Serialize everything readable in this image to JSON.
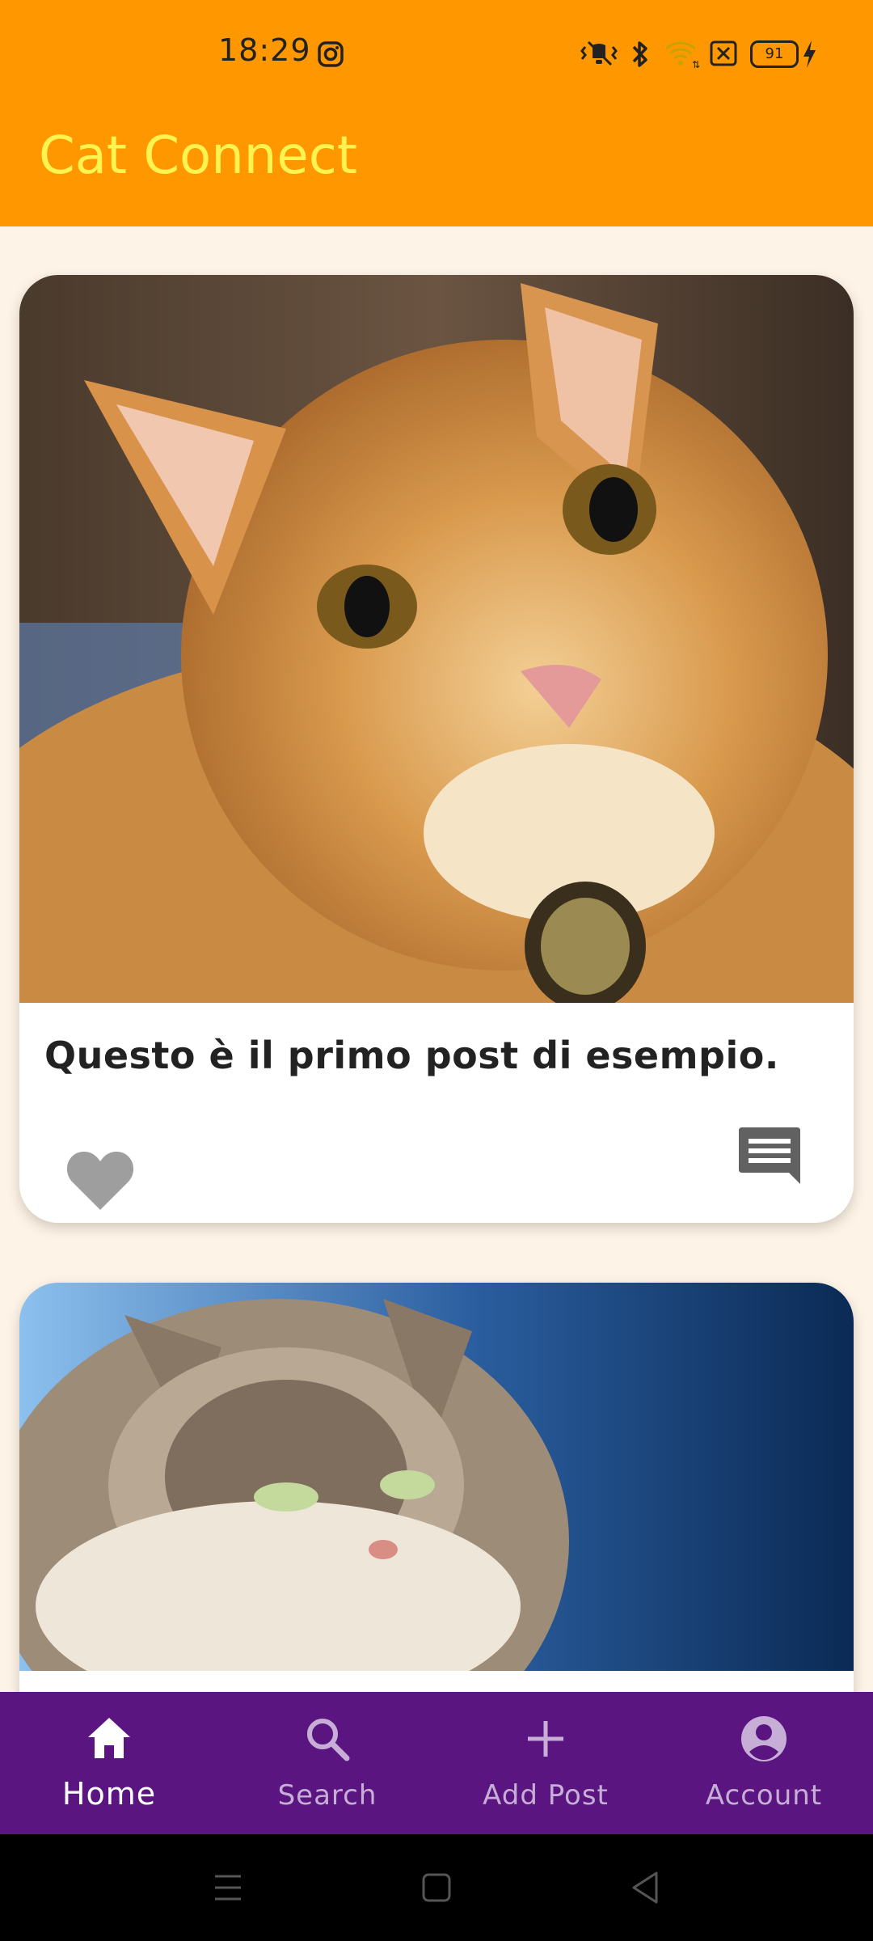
{
  "status_bar": {
    "time": "18:29",
    "battery_level": "91",
    "icons": [
      "instagram-icon",
      "vibrate-icon",
      "bluetooth-icon",
      "wifi-icon",
      "sim-off-icon",
      "battery-icon",
      "charging-icon"
    ]
  },
  "app_bar": {
    "title": "Cat Connect"
  },
  "posts": [
    {
      "caption": "Questo è il primo post di esempio.",
      "image": "orange-tabby-cat-photo",
      "liked": false
    },
    {
      "caption": "",
      "image": "fluffy-maine-coon-cat-photo",
      "liked": false
    }
  ],
  "bottom_nav": {
    "items": [
      {
        "label": "Home",
        "icon": "home-icon",
        "active": true
      },
      {
        "label": "Search",
        "icon": "search-icon",
        "active": false
      },
      {
        "label": "Add Post",
        "icon": "add-icon",
        "active": false
      },
      {
        "label": "Account",
        "icon": "account-icon",
        "active": false
      }
    ]
  },
  "colors": {
    "app_bar": "#ff9800",
    "title": "#fff44f",
    "background": "#fdf3e6",
    "bottom_nav": "#5a1580",
    "nav_active": "#ffffff",
    "nav_inactive": "#c7aed6",
    "icon_grey": "#9e9e9e"
  }
}
